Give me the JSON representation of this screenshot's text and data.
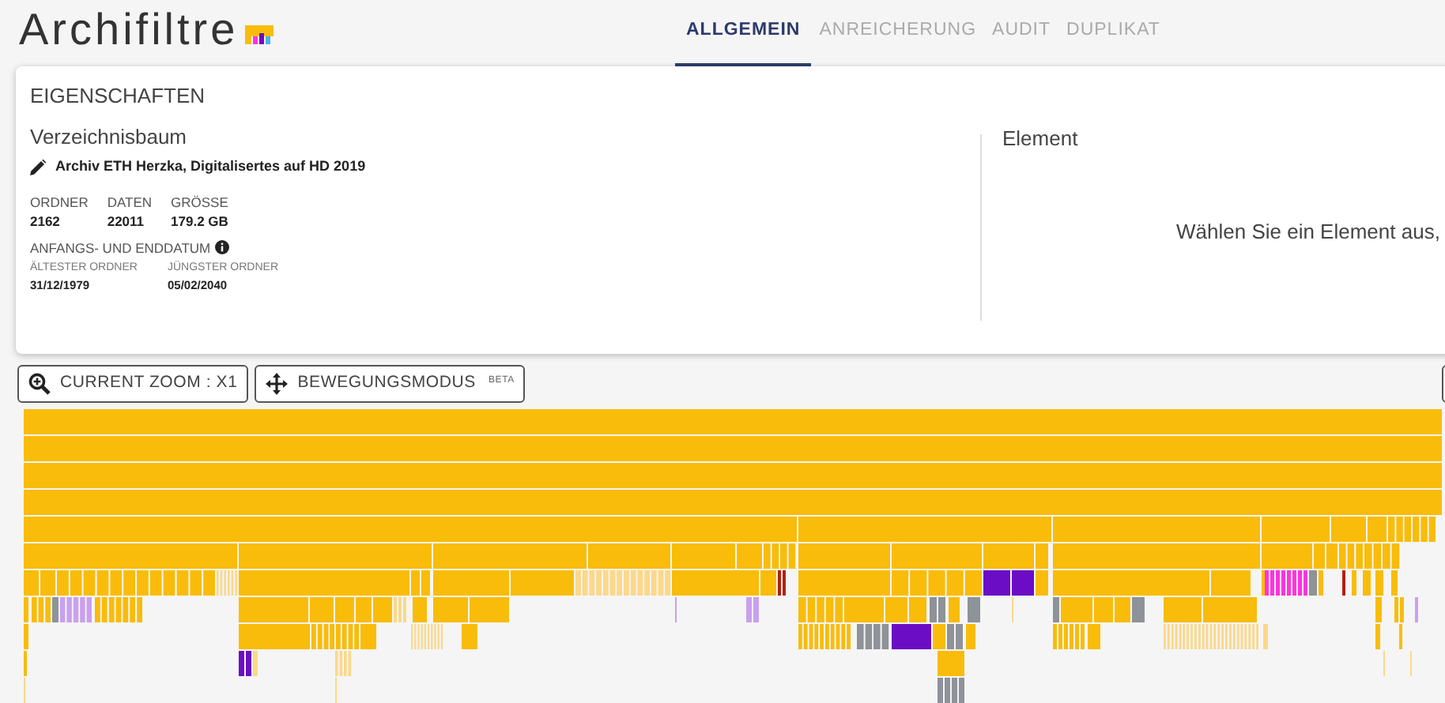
{
  "app": {
    "name": "Archifiltre"
  },
  "tabs": [
    {
      "label": "ALLGEMEIN",
      "selected": true
    },
    {
      "label": "ANREICHERUNG",
      "selected": false
    },
    {
      "label": "AUDIT",
      "selected": false
    },
    {
      "label": "DUPLIKAT",
      "selected": false
    }
  ],
  "properties": {
    "title": "EIGENSCHAFTEN",
    "tree_heading": "Verzeichnisbaum",
    "tree_name": "Archiv ETH Herzka, Digitalisertes auf HD 2019",
    "stats": [
      {
        "label": "ORDNER",
        "value": "2162"
      },
      {
        "label": "DATEN",
        "value": "22011"
      },
      {
        "label": "GRÖSSE",
        "value": "179.2 GB"
      }
    ],
    "dates_heading": "ANFANGS- UND ENDDATUM",
    "dates": [
      {
        "label": "ÄLTESTER ORDNER",
        "value": "31/12/1979"
      },
      {
        "label": "JÜNGSTER ORDNER",
        "value": "05/02/2040"
      }
    ],
    "element_heading": "Element",
    "element_hint": "Wählen Sie ein Element aus,"
  },
  "toolbar": [
    {
      "kind": "zoom",
      "label": "CURRENT ZOOM : X1"
    },
    {
      "kind": "move",
      "label": "BEWEGUNGSMODUS",
      "badge": "BETA"
    }
  ]
}
